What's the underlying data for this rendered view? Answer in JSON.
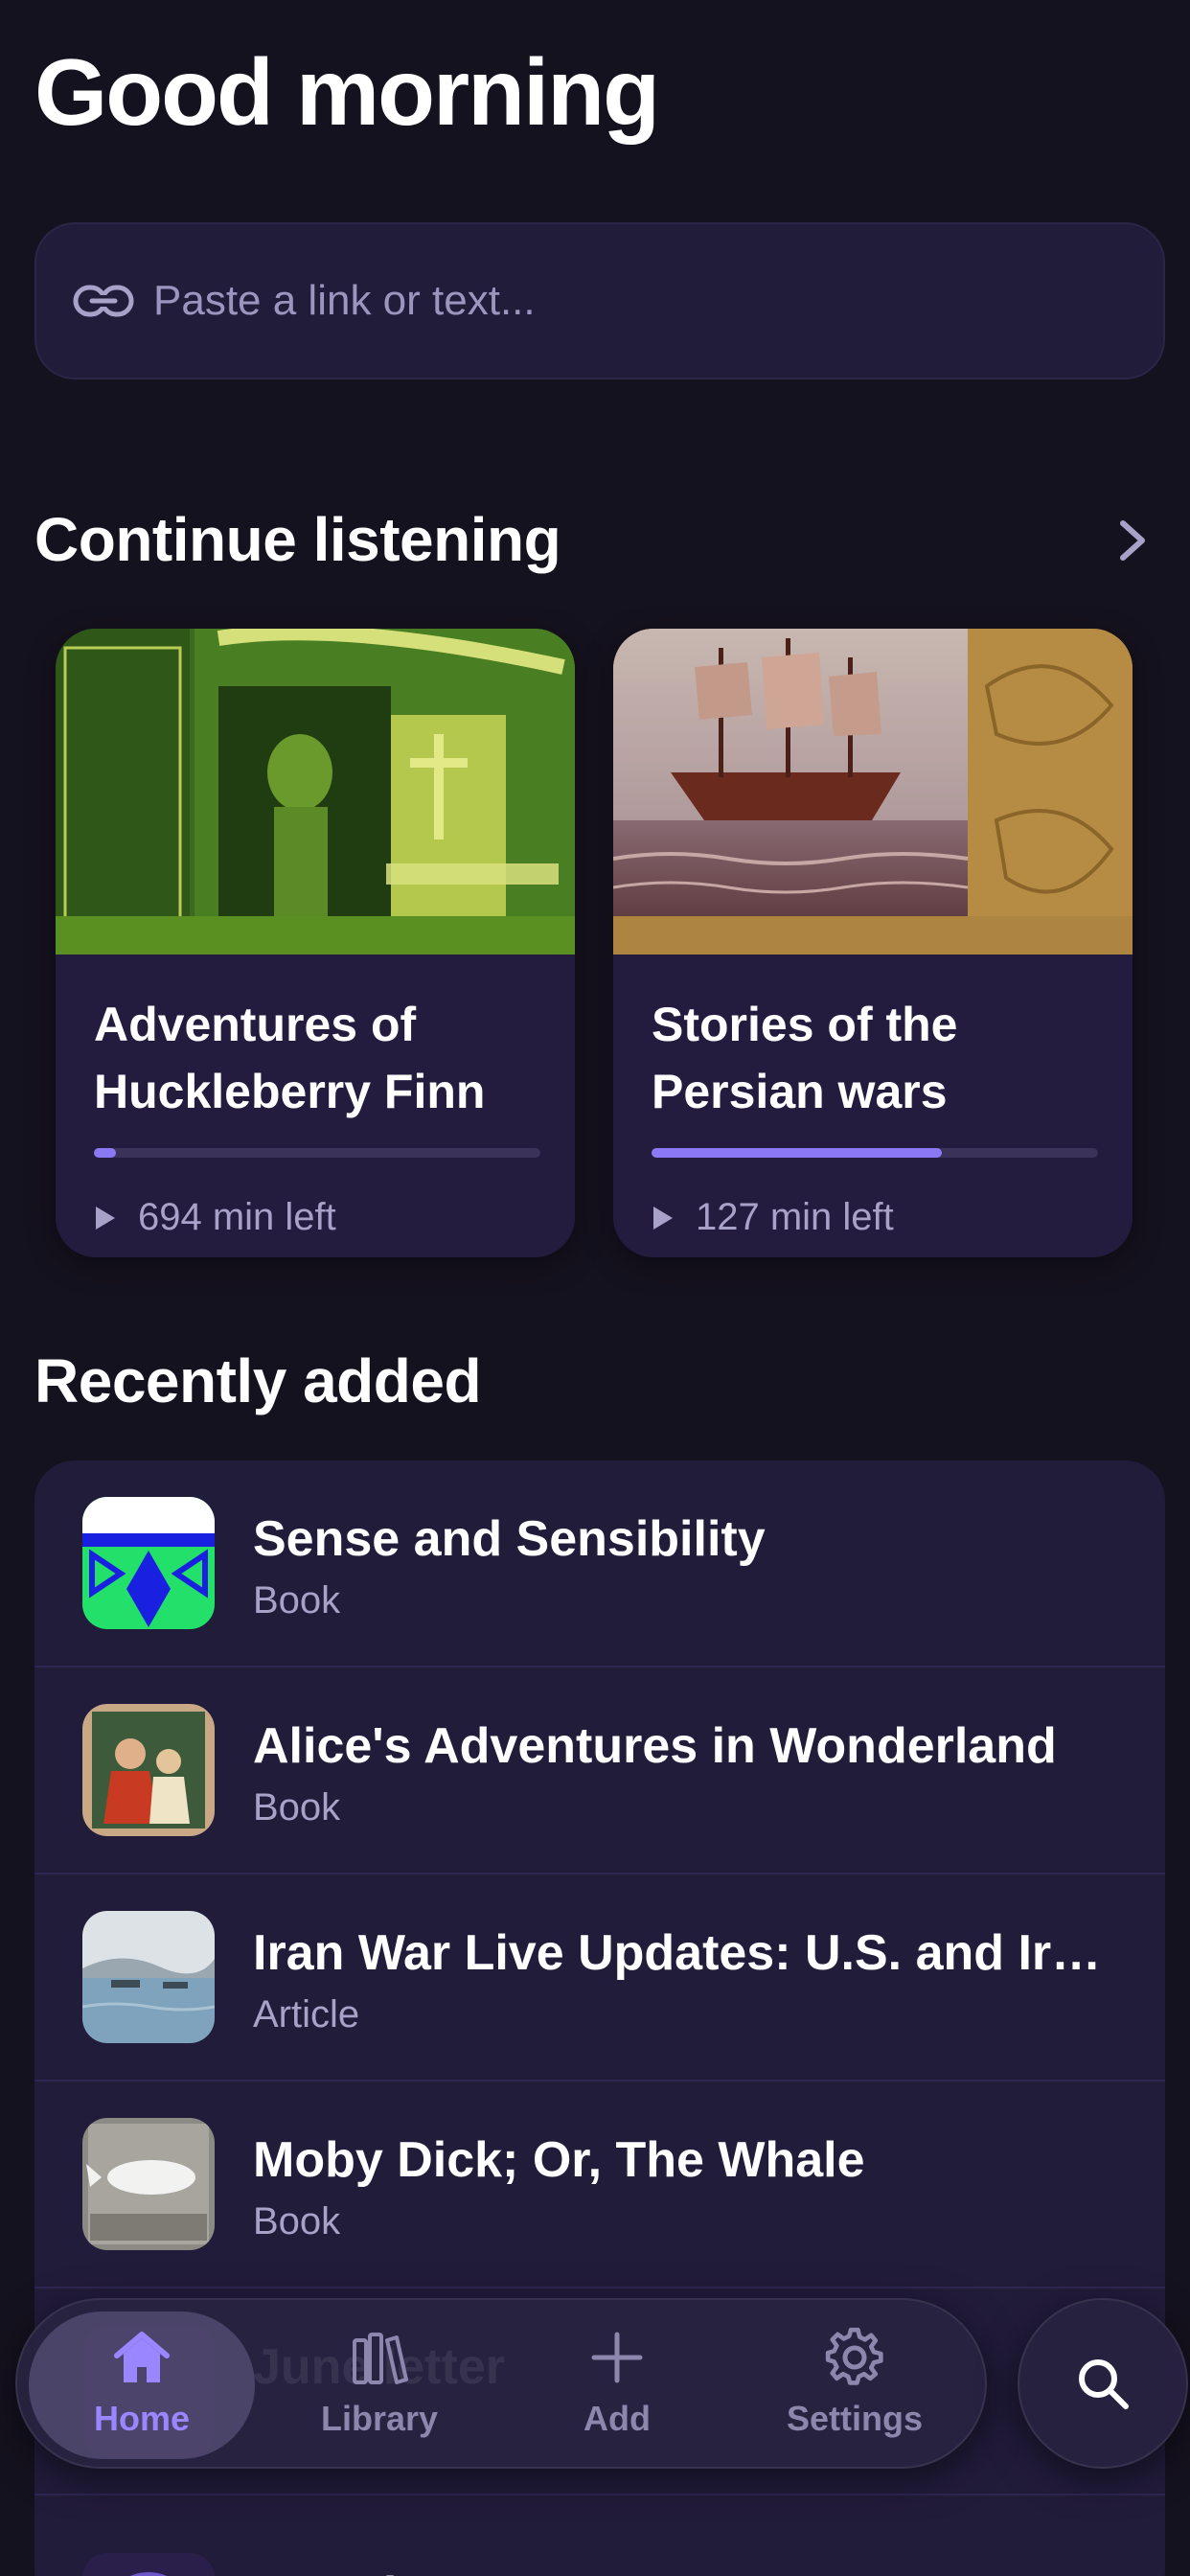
{
  "greeting": "Good morning",
  "paste": {
    "placeholder": "Paste a link or text..."
  },
  "continue_listening": {
    "title": "Continue listening",
    "items": [
      {
        "title": "Adventures of Huckleberry Finn",
        "time_left": "694 min left",
        "progress": 0.05
      },
      {
        "title": "Stories of the Persian wars",
        "time_left": "127 min left",
        "progress": 0.65
      }
    ]
  },
  "recently_added": {
    "title": "Recently added",
    "items": [
      {
        "title": "Sense and Sensibility",
        "type": "Book"
      },
      {
        "title": "Alice's Adventures in Wonderland",
        "type": "Book"
      },
      {
        "title": "Iran War Live Updates: U.S. and Ira...",
        "type": "Article"
      },
      {
        "title": "Moby Dick; Or, The Whale",
        "type": "Book"
      },
      {
        "title": "June letter",
        "type": ""
      }
    ]
  },
  "tabbar": {
    "tabs": [
      {
        "label": "Home",
        "icon": "home-icon",
        "active": true
      },
      {
        "label": "Library",
        "icon": "library-icon",
        "active": false
      },
      {
        "label": "Add",
        "icon": "plus-icon",
        "active": false
      },
      {
        "label": "Settings",
        "icon": "gear-icon",
        "active": false
      }
    ]
  },
  "colors": {
    "background": "#15121f",
    "surface": "#221c3b",
    "accent": "#8a78f5",
    "muted_text": "#a8a2c8"
  }
}
